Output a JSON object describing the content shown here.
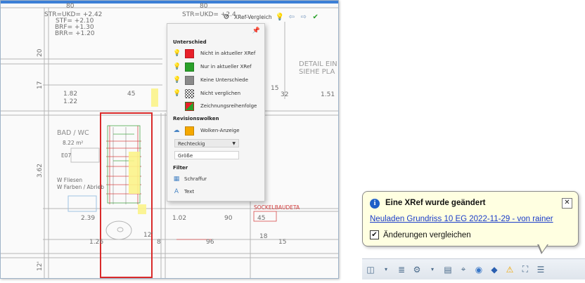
{
  "cad": {
    "labels": {
      "top_left_val": "80",
      "top_mid_val": "80",
      "str_ukd_left": "STR=UKD= +2.42",
      "stf": "STF= +2.10",
      "brf": "BRF= +1.30",
      "brr": "BRR= +1.20",
      "str_ukd_right": "STR=UKD= +2.4",
      "dim_20": "20",
      "dim_17": "17",
      "dim_182": "1.82",
      "dim_122": "1.22",
      "dim_45": "45",
      "dim_15": "15",
      "dim_32": "32",
      "dim_151": "1.51",
      "room_bad": "BAD / WC",
      "room_area": "8.22 m²",
      "e07": "E07",
      "dim_362": "3.62",
      "fliesen": "W Fliesen",
      "fliesen2": "W Farben / Abrieb",
      "dim_239": "2.39",
      "dim_102": "1.02",
      "dim_90": "90",
      "dim_45b": "45",
      "dim_126": "1.26",
      "dim_8": "8",
      "dim_96": "96",
      "dim_12": "12'",
      "dim_18": "18",
      "dim_15b": "15",
      "dim_12b": "12'",
      "detail": "DETAIL EIN",
      "siehe": "SIEHE PLA",
      "sock": "SOCKELBAUDETA"
    },
    "toolbar": {
      "title": "XRef-Vergleich"
    },
    "panel": {
      "section_difference": "Unterschied",
      "row1": "Nicht in aktueller XRef",
      "row2": "Nur in aktueller XRef",
      "row3": "Keine Unterschiede",
      "row4": "Nicht verglichen",
      "row5": "Zeichnungsreihenfolge",
      "section_revision": "Revisionswolken",
      "row6": "Wolken-Anzeige",
      "shape_select": "Rechteckig",
      "size_field": "Größe",
      "section_filter": "Filter",
      "row7": "Schraffur",
      "row8": "Text",
      "colors": {
        "red": "#e8202a",
        "green": "#2aa12a",
        "gray": "#8a8a8a",
        "orange": "#f5a800"
      }
    }
  },
  "balloon": {
    "title": "Eine XRef wurde geändert",
    "link": "Neuladen Grundriss 10 EG 2022-11-29 - von rainer",
    "checkbox_label": "Änderungen vergleichen",
    "checked": true
  }
}
